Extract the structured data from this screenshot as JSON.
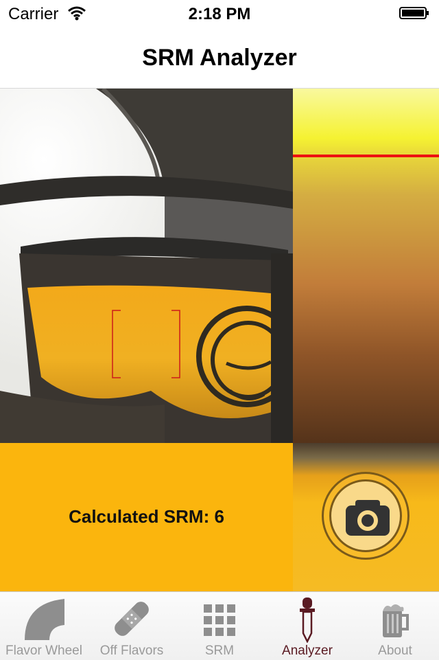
{
  "status_bar": {
    "carrier": "Carrier",
    "time": "2:18 PM"
  },
  "nav": {
    "title": "SRM Analyzer"
  },
  "result": {
    "srm_label": "Calculated SRM: 6",
    "srm_value": 6
  },
  "colors": {
    "result_bg": "#fbb50d",
    "marker": "#ee1111",
    "tab_active": "#5a1a22",
    "tab_inactive": "#9a9a9a"
  },
  "tabs": [
    {
      "label": "Flavor Wheel",
      "icon": "flavor-wheel-icon",
      "active": false
    },
    {
      "label": "Off Flavors",
      "icon": "bandage-icon",
      "active": false
    },
    {
      "label": "SRM",
      "icon": "grid-icon",
      "active": false
    },
    {
      "label": "Analyzer",
      "icon": "dropper-icon",
      "active": true
    },
    {
      "label": "About",
      "icon": "beer-mug-icon",
      "active": false
    }
  ]
}
